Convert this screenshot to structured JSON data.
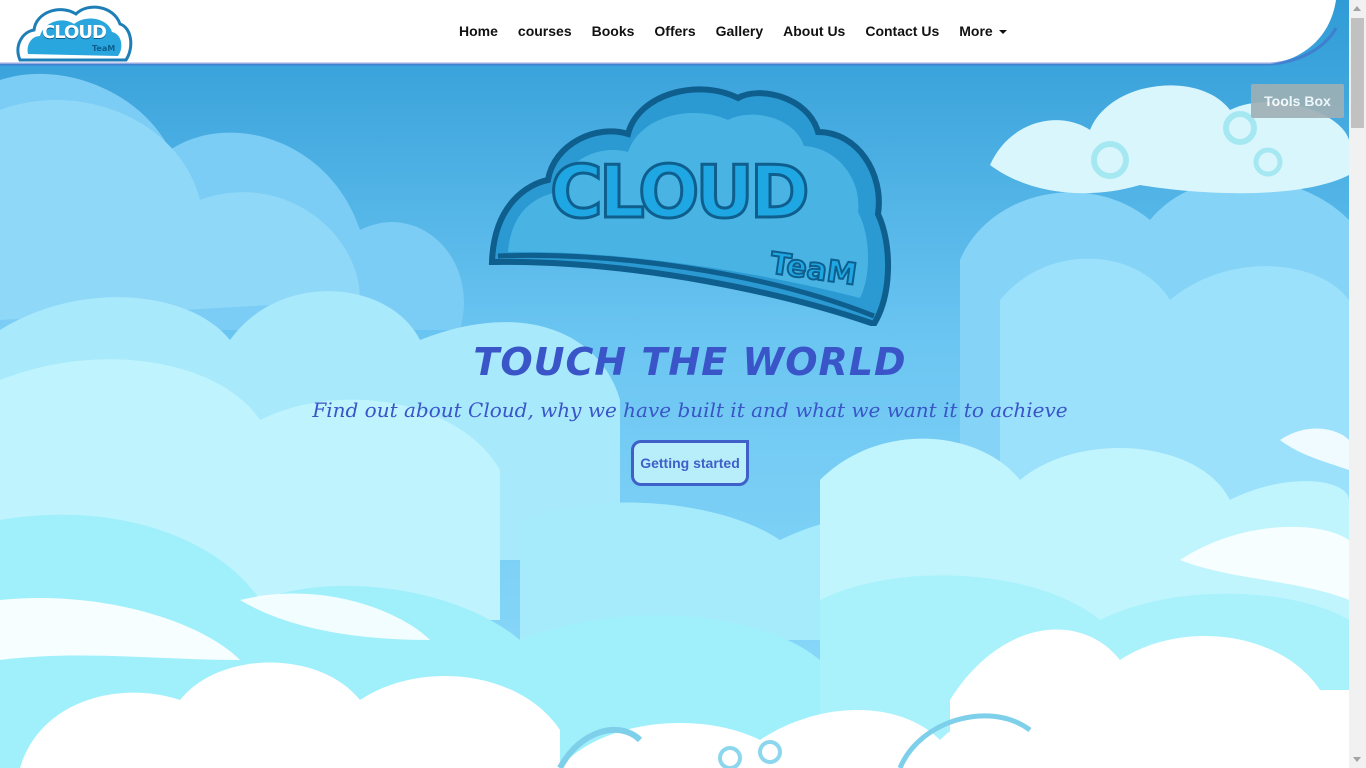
{
  "brand": {
    "logo_text": "CLOUD",
    "logo_subtext": "TeaM"
  },
  "nav": {
    "items": [
      {
        "label": "Home"
      },
      {
        "label": "courses"
      },
      {
        "label": "Books"
      },
      {
        "label": "Offers"
      },
      {
        "label": "Gallery"
      },
      {
        "label": "About Us"
      },
      {
        "label": "Contact Us"
      },
      {
        "label": "More"
      }
    ]
  },
  "tools_box": {
    "label": "Tools Box"
  },
  "hero": {
    "logo_text": "CLOUD",
    "logo_subtext": "TeaM",
    "title": "TOUCH THE WORLD",
    "subtitle": "Find out about Cloud, why we have built it and what we want it to achieve",
    "cta_label": "Getting started"
  },
  "colors": {
    "sky_top": "#3aa6dd",
    "sky_mid": "#7fd0f7",
    "cloud_light": "#b8eef9",
    "cloud_white": "#ffffff",
    "accent": "#3955c8",
    "tools_box": "#9fb0b5"
  }
}
